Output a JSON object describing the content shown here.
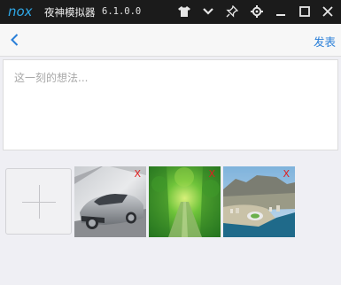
{
  "titlebar": {
    "logo": "nox",
    "app_name": "夜神模拟器",
    "version": "6.1.0.0",
    "icons": [
      "shirt-icon",
      "chevron-down-icon",
      "pin-icon",
      "gear-icon",
      "minimize-icon",
      "maximize-icon",
      "close-icon"
    ]
  },
  "toolbar": {
    "back_icon": "chevron-left-icon",
    "publish_label": "发表"
  },
  "composer": {
    "placeholder": "这一刻的想法..."
  },
  "images": {
    "add_icon": "plus-icon",
    "remove_label": "X",
    "items": [
      {
        "subject": "car"
      },
      {
        "subject": "forest-road"
      },
      {
        "subject": "coastal-city"
      }
    ]
  },
  "colors": {
    "accent": "#2a7fd8",
    "remove": "#e02020",
    "titlebar_bg": "#1b1b1b",
    "page_bg": "#efeff4"
  }
}
